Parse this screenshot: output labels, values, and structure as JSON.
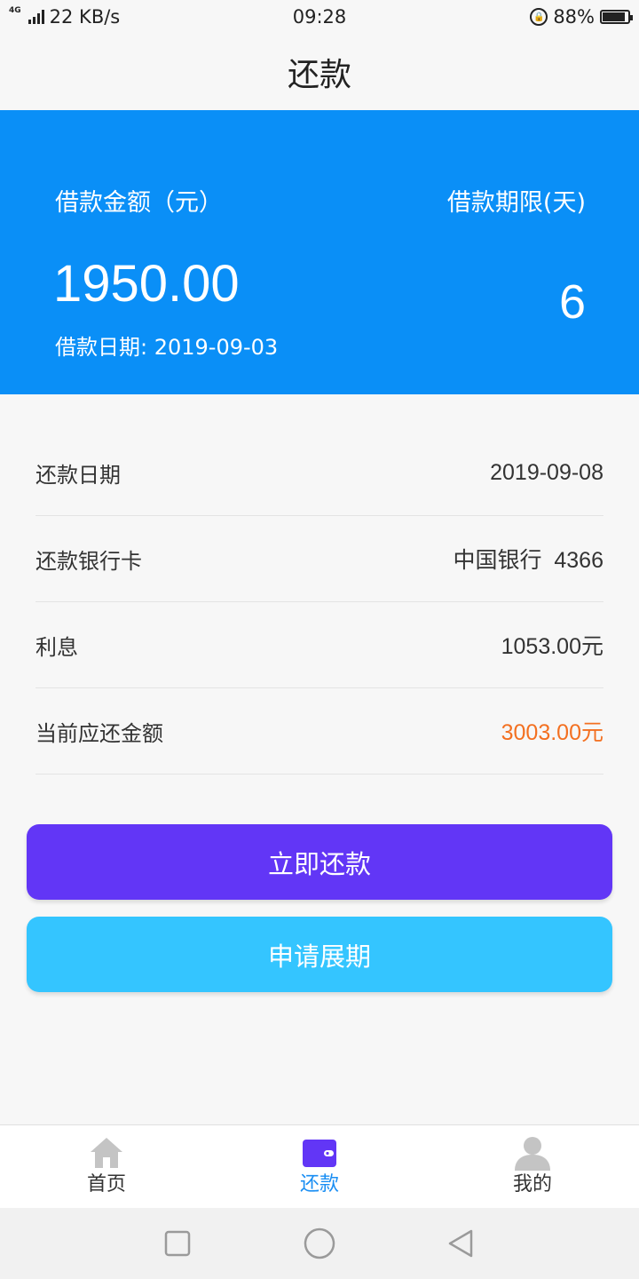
{
  "status_bar": {
    "network_tag": "4G",
    "speed": "22 KB/s",
    "time": "09:28",
    "battery": "88%",
    "battery_level": 0.88
  },
  "header": {
    "title": "还款"
  },
  "summary": {
    "amount_label": "借款金额（元）",
    "amount_value": "1950.00",
    "term_label": "借款期限(天)",
    "term_value": "6",
    "loan_date": "借款日期: 2019-09-03"
  },
  "details": [
    {
      "label": "还款日期",
      "value": "2019-09-08"
    },
    {
      "label": "还款银行卡",
      "value": "中国银行  4366"
    },
    {
      "label": "利息",
      "value": "1053.00元"
    },
    {
      "label": "当前应还金额",
      "value": "3003.00元"
    }
  ],
  "colors": {
    "brand_blue": "#0a8ff7",
    "repay_button": "#6236f6",
    "extend_button": "#34c5ff",
    "amount_due": "#f37021",
    "nav_active": "#1a8ef3"
  },
  "buttons": {
    "repay_now": "立即还款",
    "apply_extension": "申请展期"
  },
  "bottom_nav": [
    {
      "label": "首页",
      "icon": "home-icon"
    },
    {
      "label": "还款",
      "icon": "wallet-icon"
    },
    {
      "label": "我的",
      "icon": "user-icon"
    }
  ]
}
